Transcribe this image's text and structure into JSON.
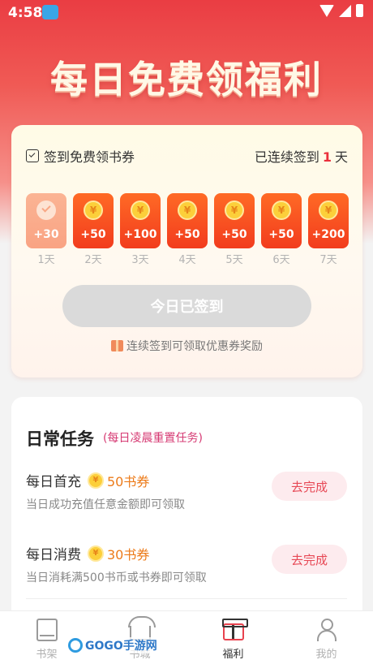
{
  "status_bar": {
    "time": "4:58"
  },
  "hero": {
    "title": "每日免费领福利"
  },
  "checkin": {
    "header_left": "签到免费领书券",
    "streak_prefix": "已连续签到",
    "streak_days": "1",
    "streak_suffix": "天",
    "days": [
      {
        "reward": "+30",
        "label": "1天",
        "signed": true
      },
      {
        "reward": "+50",
        "label": "2天",
        "signed": false
      },
      {
        "reward": "+100",
        "label": "3天",
        "signed": false
      },
      {
        "reward": "+50",
        "label": "4天",
        "signed": false
      },
      {
        "reward": "+50",
        "label": "5天",
        "signed": false
      },
      {
        "reward": "+50",
        "label": "6天",
        "signed": false
      },
      {
        "reward": "+200",
        "label": "7天",
        "signed": false
      }
    ],
    "coin_symbol": "¥",
    "button_label": "今日已签到",
    "hint": "连续签到可领取优惠券奖励"
  },
  "tasks": {
    "title": "日常任务",
    "subtitle": "(每日凌晨重置任务)",
    "items": [
      {
        "name": "每日首充",
        "reward": "50书券",
        "desc": "当日成功充值任意金额即可领取",
        "button": "去完成"
      },
      {
        "name": "每日消费",
        "reward": "30书券",
        "desc": "当日消耗满500书币或书券即可领取",
        "button": "去完成"
      }
    ]
  },
  "tabbar": {
    "items": [
      {
        "label": "书架",
        "icon": "bookshelf-icon",
        "active": false
      },
      {
        "label": "书城",
        "icon": "bookstore-icon",
        "active": false
      },
      {
        "label": "福利",
        "icon": "gift-icon",
        "active": true
      },
      {
        "label": "我的",
        "icon": "profile-icon",
        "active": false
      }
    ]
  },
  "watermark": {
    "text": "GOGO手游网"
  },
  "colors": {
    "accent": "#ea2f3b",
    "hero_red": "#ea3d43",
    "reward_orange": "#ec7b1a",
    "task_button_bg": "#fdebee"
  }
}
